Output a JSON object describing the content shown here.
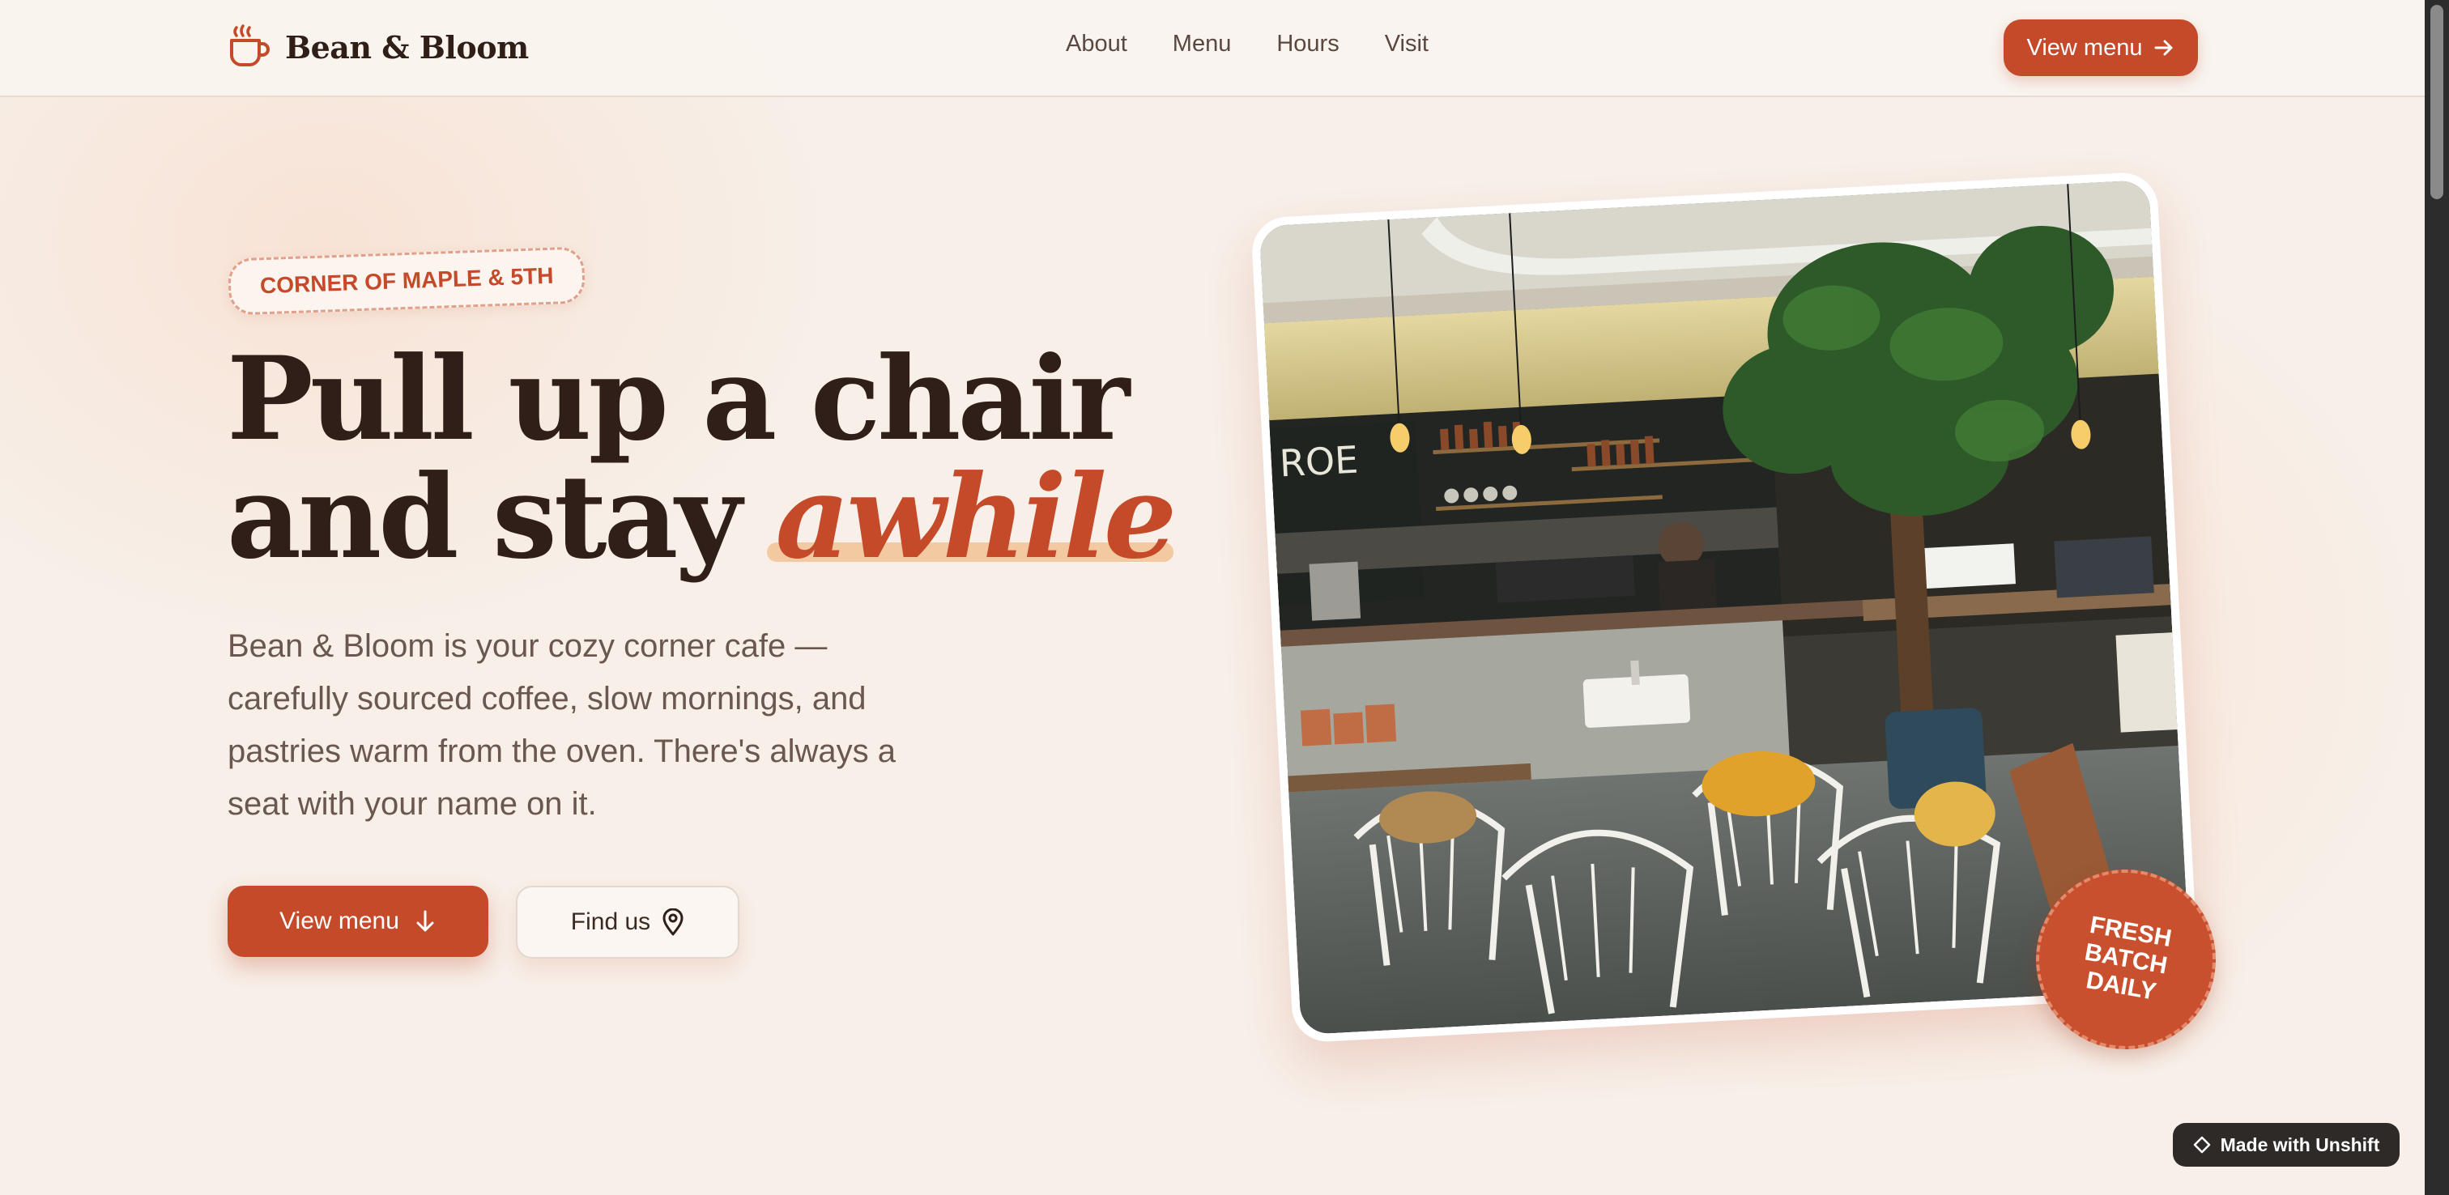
{
  "brand": {
    "name": "Bean & Bloom",
    "icon": "coffee-cup-icon"
  },
  "nav": {
    "items": [
      "About",
      "Menu",
      "Hours",
      "Visit"
    ]
  },
  "header": {
    "cta_label": "View menu",
    "cta_icon": "arrow-right-icon"
  },
  "hero": {
    "badge": "CORNER OF MAPLE & 5TH",
    "headline_line1": "Pull up a chair",
    "headline_line2_plain": "and stay ",
    "headline_accent": "awhile",
    "lede": "Bean & Bloom is your cozy corner cafe — carefully sourced coffee, slow mornings, and pastries warm from the oven. There's always a seat with your name on it.",
    "primary_button": "View menu",
    "primary_icon": "arrow-down-icon",
    "secondary_button": "Find us",
    "secondary_icon": "map-pin-icon",
    "stamp_text": "FRESH BATCH DAILY"
  },
  "footer_badge": {
    "label": "Made with Unshift",
    "icon": "diamond-icon"
  },
  "colors": {
    "accent": "#c44a2a",
    "background": "#f7efe8",
    "heading": "#2f1f18",
    "highlight": "#f3c9a2"
  }
}
